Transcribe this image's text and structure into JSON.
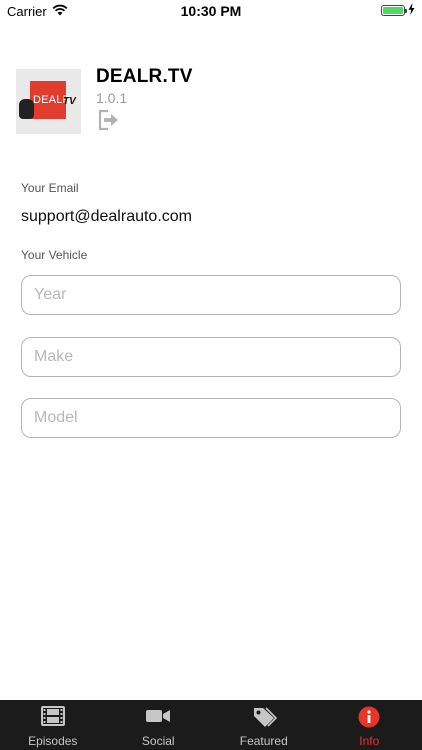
{
  "status_bar": {
    "carrier": "Carrier",
    "time": "10:30 PM",
    "battery_level": 1.0
  },
  "app": {
    "name": "DEALR.TV",
    "version": "1.0.1",
    "logo_text": "DEALR",
    "logo_suffix": "TV",
    "brand_color": "#e03d2f"
  },
  "form": {
    "email_label": "Your Email",
    "email_value": "support@dealrauto.com",
    "vehicle_label": "Your Vehicle",
    "year_placeholder": "Year",
    "make_placeholder": "Make",
    "model_placeholder": "Model"
  },
  "tab_bar": {
    "active_color": "#e8352a",
    "tabs": [
      {
        "label": "Episodes",
        "icon": "film-icon"
      },
      {
        "label": "Social",
        "icon": "video-camera-icon"
      },
      {
        "label": "Featured",
        "icon": "tags-icon"
      },
      {
        "label": "Info",
        "icon": "info-icon"
      }
    ]
  }
}
